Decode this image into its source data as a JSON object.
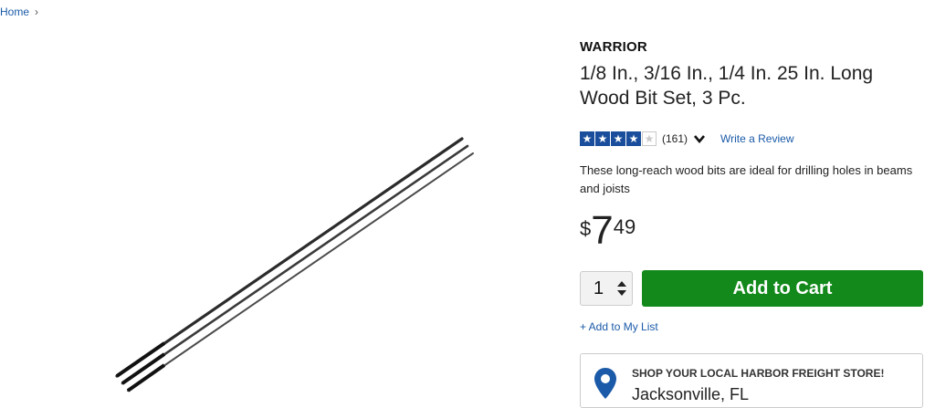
{
  "breadcrumb": {
    "home": "Home",
    "separator": "›"
  },
  "product": {
    "brand": "WARRIOR",
    "title": "1/8 In., 3/16 In., 1/4 In. 25 In. Long Wood Bit Set, 3 Pc.",
    "rating_stars": 4,
    "rating_max": 5,
    "review_count": "(161)",
    "write_review": "Write a Review",
    "description": "These long-reach wood bits are ideal for drilling holes in beams and joists",
    "price": {
      "currency": "$",
      "whole": "7",
      "cents": "49"
    }
  },
  "purchase": {
    "quantity": "1",
    "add_to_cart": "Add to Cart",
    "add_to_list": "+ Add to My List"
  },
  "store": {
    "heading": "SHOP YOUR LOCAL HARBOR FREIGHT STORE!",
    "city": "Jacksonville, FL"
  },
  "colors": {
    "link": "#1a5aa8",
    "cart_button": "#12891a",
    "star": "#1a4e9c"
  }
}
